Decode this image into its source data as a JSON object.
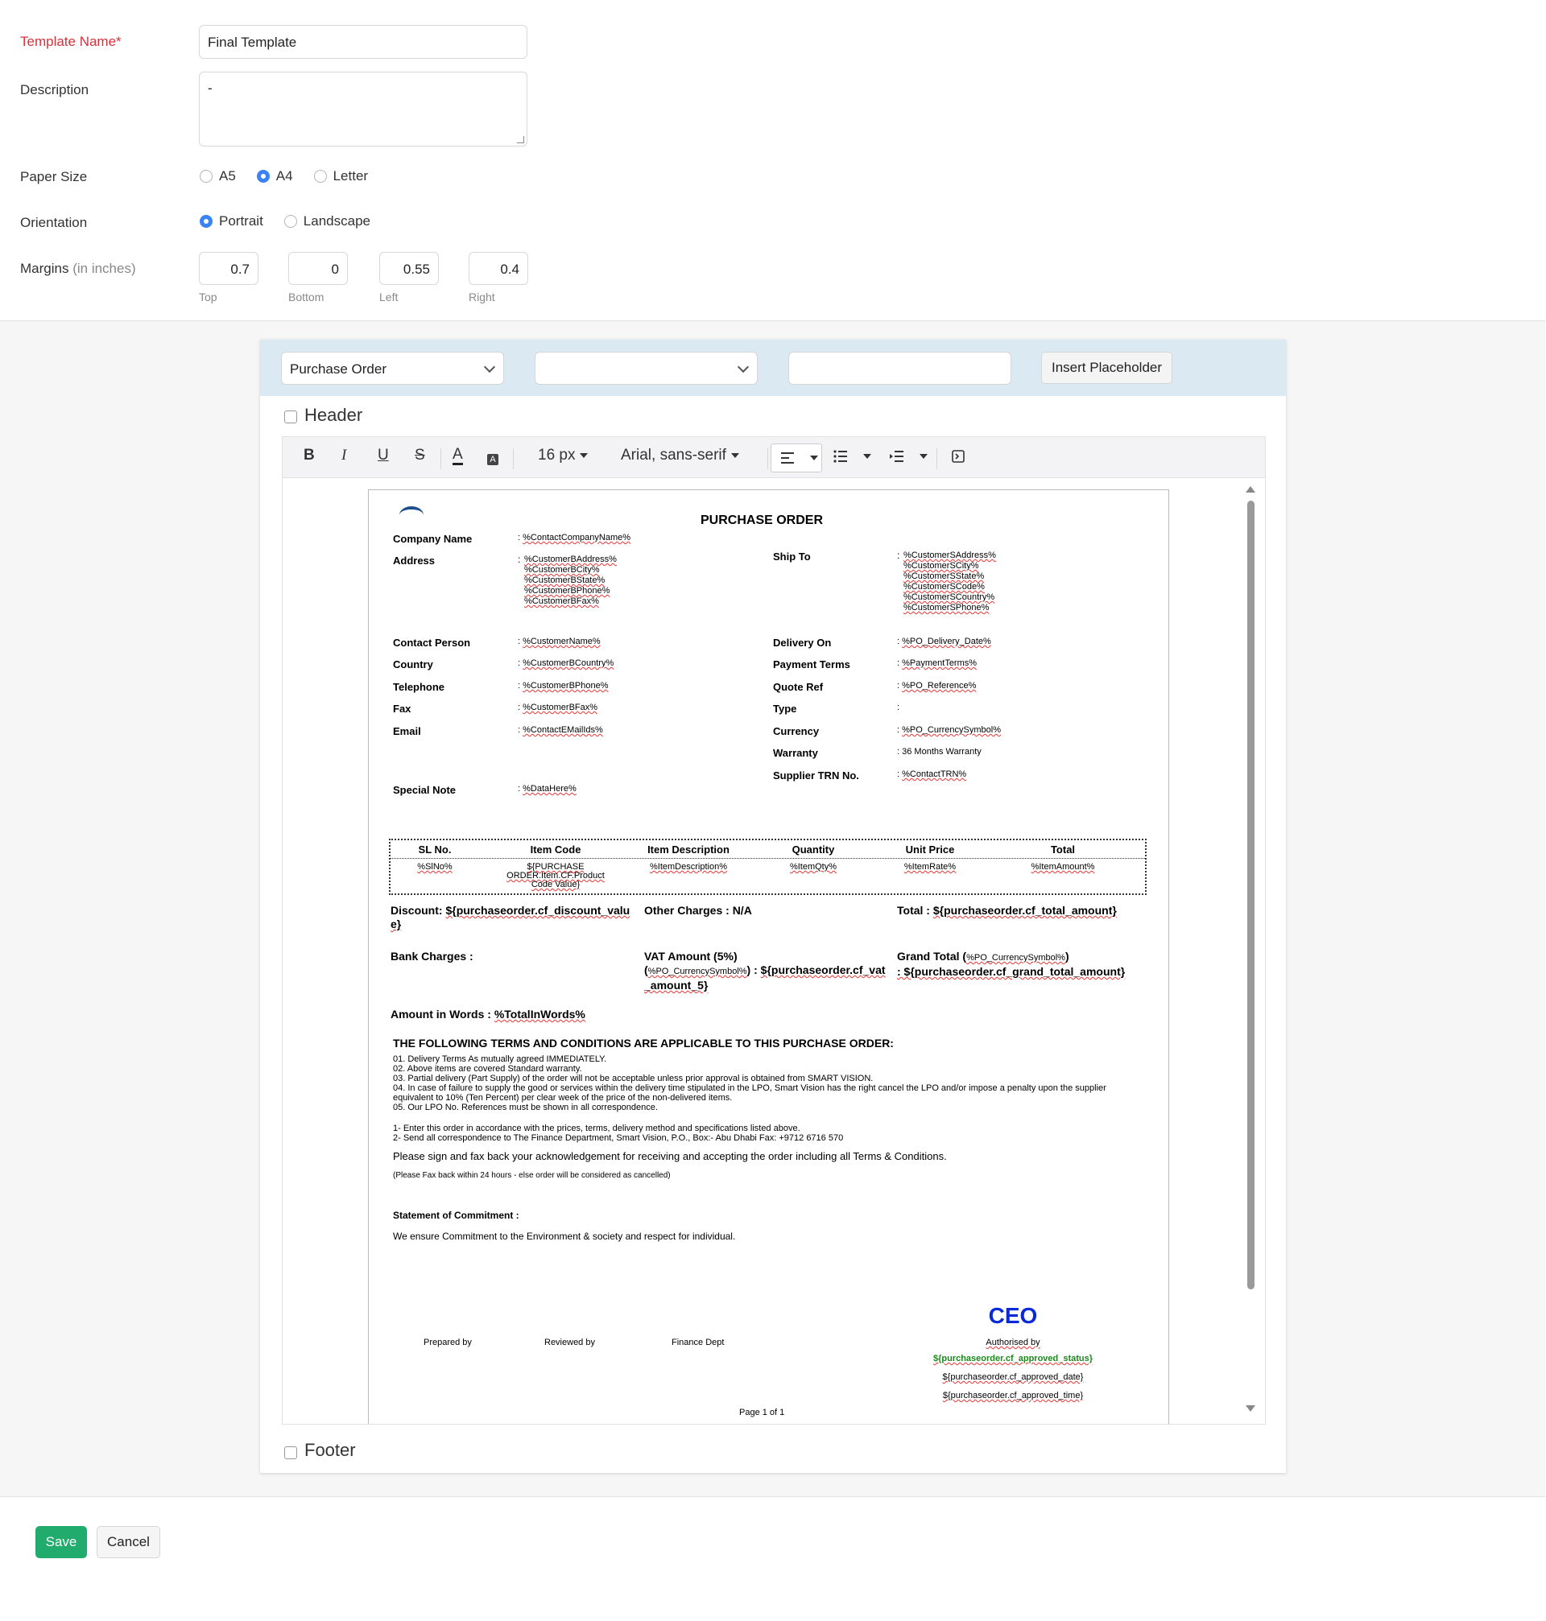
{
  "form": {
    "template_name_label": "Template Name*",
    "template_name_value": "Final Template",
    "description_label": "Description",
    "description_value": "-",
    "paper_size_label": "Paper Size",
    "paper_sizes": [
      "A5",
      "A4",
      "Letter"
    ],
    "paper_size_selected": "A4",
    "orientation_label": "Orientation",
    "orientations": [
      "Portrait",
      "Landscape"
    ],
    "orientation_selected": "Portrait",
    "margins_label": "Margins",
    "margins_unit": "(in inches)",
    "margins": {
      "top": "0.7",
      "bottom": "0",
      "left": "0.55",
      "right": "0.4"
    },
    "margin_captions": {
      "top": "Top",
      "bottom": "Bottom",
      "left": "Left",
      "right": "Right"
    }
  },
  "placeholder_bar": {
    "module_select": "Purchase Order",
    "field_select": "",
    "placeholder_value": "",
    "insert_button": "Insert Placeholder"
  },
  "header_label": "Header",
  "footer_label": "Footer",
  "toolbar": {
    "bold": "B",
    "italic": "I",
    "underline": "U",
    "strike": "S",
    "font_size": "16 px",
    "font_family": "Arial, sans-serif"
  },
  "document": {
    "title": "PURCHASE ORDER",
    "left_fields": [
      {
        "label": "Company Name",
        "value": "%ContactCompanyName%"
      },
      {
        "label": "Address",
        "value": "%CustomerBAddress%\n%CustomerBCity%\n%CustomerBState%\n%CustomerBPhone%\n%CustomerBFax%"
      },
      {
        "label": "Contact Person",
        "value": "%CustomerName%"
      },
      {
        "label": "Country",
        "value": "%CustomerBCountry%"
      },
      {
        "label": "Telephone",
        "value": "%CustomerBPhone%"
      },
      {
        "label": "Fax",
        "value": "%CustomerBFax%"
      },
      {
        "label": "Email",
        "value": "%ContactEMailIds%"
      },
      {
        "label": "Special Note",
        "value": "%DataHere%"
      }
    ],
    "right_fields": [
      {
        "label": "Ship To",
        "value": "%CustomerSAddress%\n%CustomerSCity%\n%CustomerSState%\n%CustomerSCode%\n%CustomerSCountry%\n%CustomerSPhone%"
      },
      {
        "label": "Delivery On",
        "value": "%PO_Delivery_Date%"
      },
      {
        "label": "Payment Terms",
        "value": "%PaymentTerms%"
      },
      {
        "label": "Quote Ref",
        "value": "%PO_Reference%"
      },
      {
        "label": "Type",
        "value": ""
      },
      {
        "label": "Currency",
        "value": "%PO_CurrencySymbol%"
      },
      {
        "label": "Warranty",
        "value": "36 Months Warranty"
      },
      {
        "label": "Supplier TRN No.",
        "value": "%ContactTRN%"
      }
    ],
    "colon": ":",
    "table_headers": [
      "SL No.",
      "Item Code",
      "Item Description",
      "Quantity",
      "Unit Price",
      "Total"
    ],
    "table_row": [
      "%SlNo%",
      "${PURCHASE ORDER.Item.CF.Product Code Value}",
      "%ItemDescription%",
      "%ItemQty%",
      "%ItemRate%",
      "%ItemAmount%"
    ],
    "discount_label": "Discount:",
    "discount_value": "${purchaseorder.cf_discount_value}",
    "other_charges": "Other Charges : N/A",
    "total_label": "Total :",
    "total_value": "${purchaseorder.cf_total_amount}",
    "bank_charges": "Bank Charges :",
    "vat_label": "VAT Amount (5%)",
    "vat_currency": "%PO_CurrencySymbol%",
    "vat_value": "${purchaseorder.cf_vat_amount_5}",
    "grand_total_label": "Grand Total (",
    "grand_total_currency": "%PO_CurrencySymbol%",
    "grand_total_value": ": ${purchaseorder.cf_grand_total_amount}",
    "amount_words_label": "Amount in Words :",
    "amount_words_value": "%TotalInWords%",
    "terms_title": "THE FOLLOWING TERMS AND CONDITIONS ARE APPLICABLE TO THIS PURCHASE ORDER:",
    "terms": [
      "01. Delivery Terms As mutually agreed IMMEDIATELY.",
      "02. Above items are covered Standard warranty.",
      "03. Partial delivery (Part Supply) of the order will not be acceptable unless prior approval is obtained from SMART VISION.",
      "04. In case of failure to supply the good or services within the delivery time stipulated in the LPO, Smart Vision has the right cancel the LPO and/or impose a penalty upon the supplier equivalent to 10% (Ten Percent) per clear week of the price of the non-delivered items.",
      "05. Our LPO No. References must be shown in all correspondence."
    ],
    "instructions": [
      "1- Enter this order in accordance with the prices, terms, delivery method and specifications listed above.",
      "2- Send all correspondence to The Finance Department, Smart Vision, P.O., Box:- Abu Dhabi Fax: +9712 6716 570"
    ],
    "sign_note": "Please sign and fax back your acknowledgement for receiving and accepting the order including all Terms & Conditions.",
    "fax_note": "(Please Fax back within 24 hours - else order will be considered as cancelled)",
    "commitment_title": "Statement of Commitment :",
    "commitment_text": "We ensure Commitment to the Environment & society and respect for individual.",
    "ceo": "CEO",
    "prepared_by": "Prepared by",
    "reviewed_by": "Reviewed by",
    "finance_dept": "Finance Dept",
    "authorised_by": "Authorised by",
    "approved_status": "${purchaseorder.cf_approved_status}",
    "approved_date": "${purchaseorder.cf_approved_date}",
    "approved_time": "${purchaseorder.cf_approved_time}",
    "page_footer": "Page 1 of 1"
  },
  "actions": {
    "save": "Save",
    "cancel": "Cancel"
  },
  "colors": {
    "primary": "#21ab6c",
    "radio_accent": "#3b82f6",
    "required": "#d6323c",
    "placeholder_bar": "#dbe9f3",
    "ceo_blue": "#0a2ad9",
    "status_green": "#1a8a1a"
  }
}
